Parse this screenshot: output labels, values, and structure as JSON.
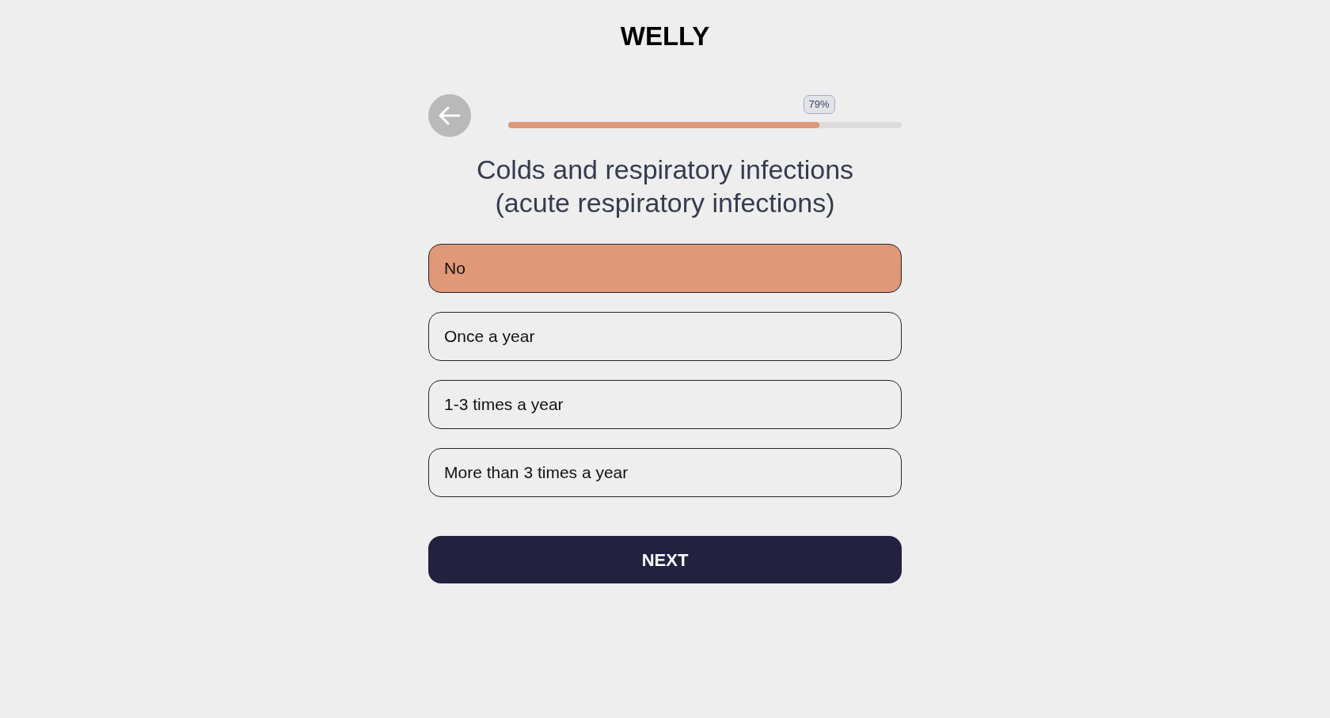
{
  "header": {
    "logo": "WELLY"
  },
  "progress": {
    "level": 0.79,
    "label": "79%"
  },
  "question": {
    "title": "Colds and respiratory infections (acute respiratory infections)"
  },
  "answers": [
    {
      "label": "No",
      "selected": true
    },
    {
      "label": "Once a year",
      "selected": false
    },
    {
      "label": "1-3 times a year",
      "selected": false
    },
    {
      "label": "More than 3 times a year",
      "selected": false
    }
  ],
  "next_button": {
    "label": "NEXT"
  }
}
